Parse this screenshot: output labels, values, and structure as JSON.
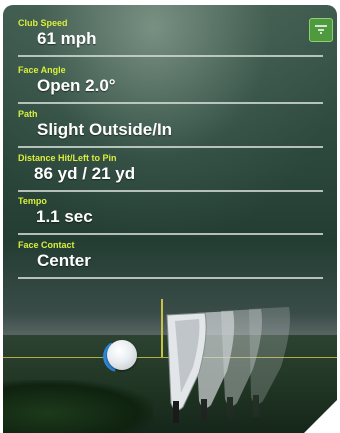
{
  "metrics": [
    {
      "label": "Club Speed",
      "value": "61 mph"
    },
    {
      "label": "Face Angle",
      "value": "Open 2.0°"
    },
    {
      "label": "Path",
      "value": "Slight Outside/In"
    },
    {
      "label": "Distance Hit/Left to Pin",
      "value": "86 yd / 21 yd"
    },
    {
      "label": "Tempo",
      "value": "1.1 sec"
    },
    {
      "label": "Face Contact",
      "value": "Center"
    }
  ],
  "colors": {
    "label": "#d9ef3c",
    "value": "#ffffff",
    "menu_tab": "#4f9a3e",
    "target_line": "#c9c247"
  },
  "icons": [
    "menu-tab-icon",
    "spin-arrow-icon",
    "golf-ball-icon",
    "golf-club-icon"
  ]
}
